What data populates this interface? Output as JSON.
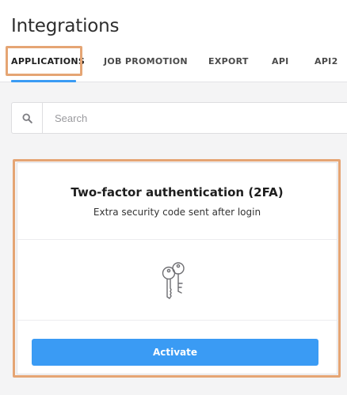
{
  "page": {
    "title": "Integrations"
  },
  "tabs": [
    {
      "label": "APPLICATIONS",
      "active": true
    },
    {
      "label": "JOB PROMOTION"
    },
    {
      "label": "EXPORT"
    },
    {
      "label": "API"
    },
    {
      "label": "API2"
    }
  ],
  "search": {
    "placeholder": "Search",
    "icon": "search-icon"
  },
  "card": {
    "title": "Two-factor authentication (2FA)",
    "subtitle": "Extra security code sent after login",
    "icon": "keys-icon",
    "action_label": "Activate"
  },
  "colors": {
    "accent": "#3a9bf4",
    "highlight": "#e5a574",
    "background": "#f4f4f5"
  }
}
